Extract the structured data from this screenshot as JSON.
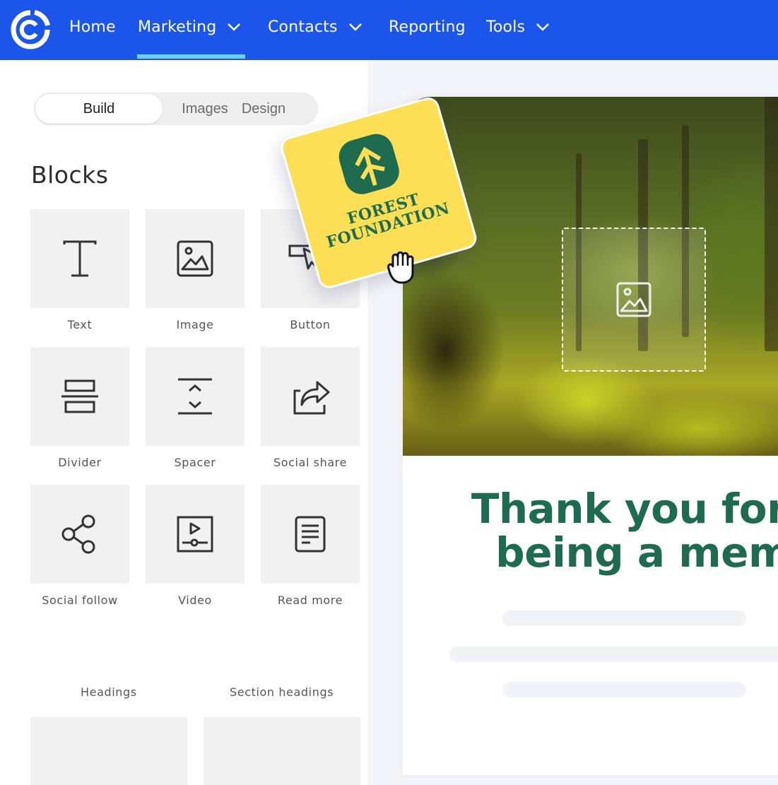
{
  "nav": {
    "logo": "constant-contact-logo",
    "items": [
      {
        "label": "Home",
        "has_dropdown": false,
        "active": false
      },
      {
        "label": "Marketing",
        "has_dropdown": true,
        "active": true
      },
      {
        "label": "Contacts",
        "has_dropdown": true,
        "active": false
      },
      {
        "label": "Reporting",
        "has_dropdown": false,
        "active": false
      },
      {
        "label": "Tools",
        "has_dropdown": true,
        "active": false
      }
    ]
  },
  "panel": {
    "tabs": [
      {
        "label": "Build",
        "active": true
      },
      {
        "label": "Images",
        "active": false
      },
      {
        "label": "Design",
        "active": false
      }
    ],
    "section_title": "Blocks",
    "blocks": [
      {
        "label": "Text",
        "icon": "text-icon"
      },
      {
        "label": "Image",
        "icon": "image-icon"
      },
      {
        "label": "Button",
        "icon": "button-cursor-icon"
      },
      {
        "label": "Divider",
        "icon": "divider-icon"
      },
      {
        "label": "Spacer",
        "icon": "spacer-icon"
      },
      {
        "label": "Social share",
        "icon": "share-icon"
      },
      {
        "label": "Social follow",
        "icon": "social-follow-icon"
      },
      {
        "label": "Video",
        "icon": "video-icon"
      },
      {
        "label": "Read more",
        "icon": "document-icon"
      }
    ],
    "layout_sections": [
      {
        "label": "Headings"
      },
      {
        "label": "Section headings"
      }
    ]
  },
  "sticker": {
    "line1": "FOREST",
    "line2": "FOUNDATION",
    "icon": "tree-icon"
  },
  "preview": {
    "headline_line1": "Thank you for",
    "headline_line2": "being a membe",
    "placeholder_icon": "image-placeholder-icon",
    "colors": {
      "headline": "#1f6b4f",
      "nav": "#1b55ea",
      "nav_active_underline": "#6cd1ff",
      "sticker": "#fddf55"
    }
  }
}
